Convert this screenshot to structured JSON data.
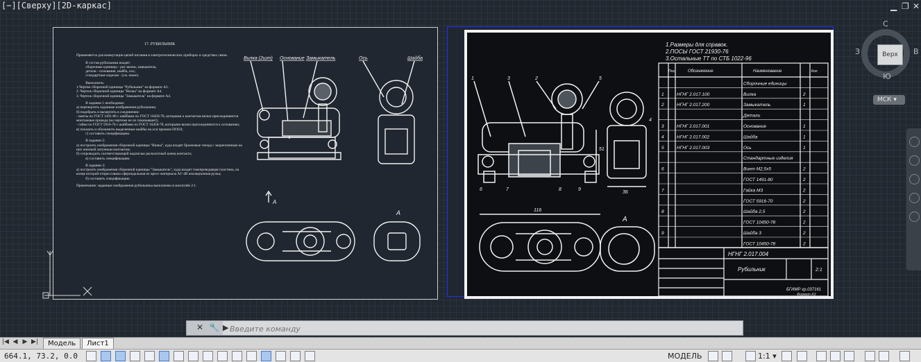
{
  "viewport": {
    "label": "[−][Сверху][2D-каркас]",
    "controls": {
      "minimize": "▁",
      "restore": "❐",
      "close": "✕"
    }
  },
  "sheet_task": {
    "title": "17. РУБИЛЬНИК",
    "paragraphs": [
      "Применяется для коммутации цепей питания в электротехнических приборах и средствах связи.",
      "          В состав рубильника входят:\n          сборочные единицы - рис вилки, замыкатель;\n          детали - основание, шайба, ось;\n          стандартные изделия - (см. ниже).",
      "          Выполнить:\n1.Чертеж сборочной единицы \"Рубильник\" на формате А3.\n2. Чертеж сборочной единицы \"Вилка\" на формате А4.\n3. Чертеж сборочной единицы \"Замыкатель\" на формате А4.",
      "          В задании 1 необходимо:\nа) перечертить заданные изображения рубильника;\nб) подобрать и вычертить в соединении:\n- винты по ГОСТ 1491-80 с шайбами по ГОСТ 10450-78, которыми к контактам вилки присоединяются монтажные провода (на чертеже не их показывают);\n- гайки по ГОСТ 5916-70 с шайбами по ГОСТ 10450-78, которыми вилки присоединяются к основанию;\nв) показать и обозначить выделенные шайбы на оси прижим ПООЗ;\n          г) составить спецификацию.",
      "          В задании 2:\nа) построить изображения сборочной единицы \"Вилка\", куда входят бронзовые гнезда с закрепленным на них кнопкой латунным контактом;\nб) сопроводить соответствующей надписью расколотный конец контакта;\n          в) составить спецификацию.",
      "          В задании 3:\nа) построить изображения сборочной единицы \"Замыкатель\", куда входят токопроводящая пластина, на конце которой отпрессована сфероидальная из пресс-материала АГ-4В изоляционная ручка;\n          б) составить спецификацию.",
      "Примечание: заданные изображения рубильника выполнены в масштабе 2:1."
    ],
    "callouts": [
      "Вилка (2шт)",
      "Основание",
      "Замыкатель",
      "Ось",
      "Шайба"
    ],
    "view_a": "A",
    "arrow_a": "A"
  },
  "sheet_drawing": {
    "notes": [
      "1.Размеры для справок.",
      "2.ПОСЫ ГОСТ 21930-76",
      "3.Остальные ТТ по СТБ 1022-96"
    ],
    "spec_headers": [
      "Поз.",
      "Обозначение",
      "Наименование",
      "Кол."
    ],
    "spec_rows": [
      [
        "",
        "",
        "Сборочные единицы",
        ""
      ],
      [
        "1",
        "НГНГ 2.017.100",
        "Вилка",
        "2"
      ],
      [
        "2",
        "НГНГ 2.017.200",
        "Замыкатель",
        "1"
      ],
      [
        "",
        "",
        "Детали",
        ""
      ],
      [
        "3",
        "НГНГ 2.017.001",
        "Основание",
        "1"
      ],
      [
        "4",
        "НГНГ 2.017.002",
        "Шайба",
        "1"
      ],
      [
        "5",
        "НГНГ 2.017.003",
        "Ось",
        "1"
      ],
      [
        "",
        "",
        "Стандартные изделия",
        ""
      ],
      [
        "6",
        "",
        "Винт М2,5х5",
        "2"
      ],
      [
        "",
        "",
        "ГОСТ 1491-80",
        "2"
      ],
      [
        "7",
        "",
        "Гайка М3",
        "2"
      ],
      [
        "",
        "",
        "ГОСТ 5916-70",
        "2"
      ],
      [
        "8",
        "",
        "Шайба 2,5",
        "2"
      ],
      [
        "",
        "",
        "ГОСТ 10450-78",
        "2"
      ],
      [
        "9",
        "",
        "Шайба 3",
        "2"
      ],
      [
        "",
        "",
        "ГОСТ 10450-78",
        "2"
      ]
    ],
    "doc_number": "НГНГ 2.017.004",
    "doc_name": "Рубильник",
    "scale": "2:1",
    "org": "БГИМР гр.037161",
    "format": "Формат А3",
    "dims": {
      "width": "116",
      "height": "51",
      "side": "36"
    },
    "positions": [
      "1",
      "2",
      "3",
      "4",
      "5",
      "6",
      "7",
      "8",
      "9"
    ],
    "view_a": "A"
  },
  "viewcube": {
    "top": "Верх",
    "north": "С",
    "south": "Ю",
    "west": "З",
    "east": "В"
  },
  "wcs": "МСК",
  "command": {
    "placeholder": "Введите команду",
    "prompt": "▶"
  },
  "tabs": {
    "model": "Модель",
    "sheet": "Лист1"
  },
  "status": {
    "coords": "664.1, 73.2, 0.0",
    "mode": "МОДЕЛЬ",
    "scale": "1:1 ▾"
  }
}
